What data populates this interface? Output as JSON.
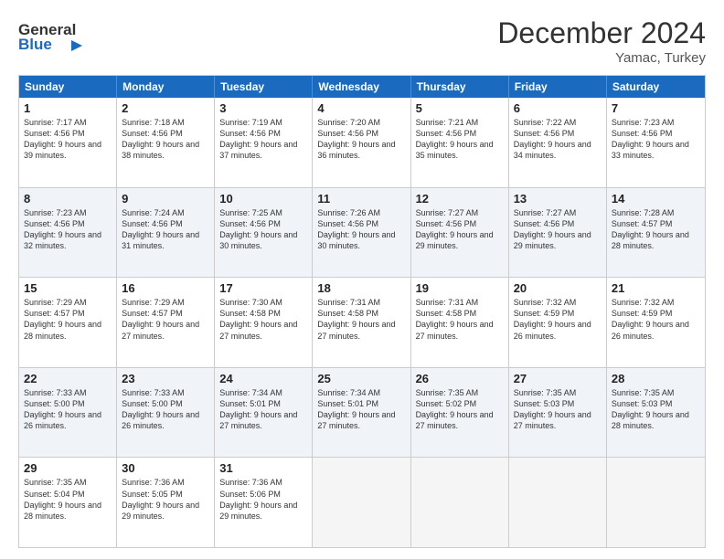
{
  "header": {
    "logo_general": "General",
    "logo_blue": "Blue",
    "month_title": "December 2024",
    "location": "Yamac, Turkey"
  },
  "calendar": {
    "days_of_week": [
      "Sunday",
      "Monday",
      "Tuesday",
      "Wednesday",
      "Thursday",
      "Friday",
      "Saturday"
    ],
    "weeks": [
      [
        {
          "day": "",
          "empty": true
        },
        {
          "day": "",
          "empty": true
        },
        {
          "day": "",
          "empty": true
        },
        {
          "day": "",
          "empty": true
        },
        {
          "day": "5",
          "sunrise": "7:21 AM",
          "sunset": "4:56 PM",
          "daylight": "9 hours and 35 minutes."
        },
        {
          "day": "6",
          "sunrise": "7:22 AM",
          "sunset": "4:56 PM",
          "daylight": "9 hours and 34 minutes."
        },
        {
          "day": "7",
          "sunrise": "7:23 AM",
          "sunset": "4:56 PM",
          "daylight": "9 hours and 33 minutes."
        }
      ],
      [
        {
          "day": "1",
          "sunrise": "7:17 AM",
          "sunset": "4:56 PM",
          "daylight": "9 hours and 39 minutes."
        },
        {
          "day": "2",
          "sunrise": "7:18 AM",
          "sunset": "4:56 PM",
          "daylight": "9 hours and 38 minutes."
        },
        {
          "day": "3",
          "sunrise": "7:19 AM",
          "sunset": "4:56 PM",
          "daylight": "9 hours and 37 minutes."
        },
        {
          "day": "4",
          "sunrise": "7:20 AM",
          "sunset": "4:56 PM",
          "daylight": "9 hours and 36 minutes."
        },
        {
          "day": "5",
          "sunrise": "7:21 AM",
          "sunset": "4:56 PM",
          "daylight": "9 hours and 35 minutes."
        },
        {
          "day": "6",
          "sunrise": "7:22 AM",
          "sunset": "4:56 PM",
          "daylight": "9 hours and 34 minutes."
        },
        {
          "day": "7",
          "sunrise": "7:23 AM",
          "sunset": "4:56 PM",
          "daylight": "9 hours and 33 minutes."
        }
      ],
      [
        {
          "day": "8",
          "sunrise": "7:23 AM",
          "sunset": "4:56 PM",
          "daylight": "9 hours and 32 minutes."
        },
        {
          "day": "9",
          "sunrise": "7:24 AM",
          "sunset": "4:56 PM",
          "daylight": "9 hours and 31 minutes."
        },
        {
          "day": "10",
          "sunrise": "7:25 AM",
          "sunset": "4:56 PM",
          "daylight": "9 hours and 30 minutes."
        },
        {
          "day": "11",
          "sunrise": "7:26 AM",
          "sunset": "4:56 PM",
          "daylight": "9 hours and 30 minutes."
        },
        {
          "day": "12",
          "sunrise": "7:27 AM",
          "sunset": "4:56 PM",
          "daylight": "9 hours and 29 minutes."
        },
        {
          "day": "13",
          "sunrise": "7:27 AM",
          "sunset": "4:56 PM",
          "daylight": "9 hours and 29 minutes."
        },
        {
          "day": "14",
          "sunrise": "7:28 AM",
          "sunset": "4:57 PM",
          "daylight": "9 hours and 28 minutes."
        }
      ],
      [
        {
          "day": "15",
          "sunrise": "7:29 AM",
          "sunset": "4:57 PM",
          "daylight": "9 hours and 28 minutes."
        },
        {
          "day": "16",
          "sunrise": "7:29 AM",
          "sunset": "4:57 PM",
          "daylight": "9 hours and 27 minutes."
        },
        {
          "day": "17",
          "sunrise": "7:30 AM",
          "sunset": "4:58 PM",
          "daylight": "9 hours and 27 minutes."
        },
        {
          "day": "18",
          "sunrise": "7:31 AM",
          "sunset": "4:58 PM",
          "daylight": "9 hours and 27 minutes."
        },
        {
          "day": "19",
          "sunrise": "7:31 AM",
          "sunset": "4:58 PM",
          "daylight": "9 hours and 27 minutes."
        },
        {
          "day": "20",
          "sunrise": "7:32 AM",
          "sunset": "4:59 PM",
          "daylight": "9 hours and 26 minutes."
        },
        {
          "day": "21",
          "sunrise": "7:32 AM",
          "sunset": "4:59 PM",
          "daylight": "9 hours and 26 minutes."
        }
      ],
      [
        {
          "day": "22",
          "sunrise": "7:33 AM",
          "sunset": "5:00 PM",
          "daylight": "9 hours and 26 minutes."
        },
        {
          "day": "23",
          "sunrise": "7:33 AM",
          "sunset": "5:00 PM",
          "daylight": "9 hours and 26 minutes."
        },
        {
          "day": "24",
          "sunrise": "7:34 AM",
          "sunset": "5:01 PM",
          "daylight": "9 hours and 27 minutes."
        },
        {
          "day": "25",
          "sunrise": "7:34 AM",
          "sunset": "5:01 PM",
          "daylight": "9 hours and 27 minutes."
        },
        {
          "day": "26",
          "sunrise": "7:35 AM",
          "sunset": "5:02 PM",
          "daylight": "9 hours and 27 minutes."
        },
        {
          "day": "27",
          "sunrise": "7:35 AM",
          "sunset": "5:03 PM",
          "daylight": "9 hours and 27 minutes."
        },
        {
          "day": "28",
          "sunrise": "7:35 AM",
          "sunset": "5:03 PM",
          "daylight": "9 hours and 28 minutes."
        }
      ],
      [
        {
          "day": "29",
          "sunrise": "7:35 AM",
          "sunset": "5:04 PM",
          "daylight": "9 hours and 28 minutes."
        },
        {
          "day": "30",
          "sunrise": "7:36 AM",
          "sunset": "5:05 PM",
          "daylight": "9 hours and 29 minutes."
        },
        {
          "day": "31",
          "sunrise": "7:36 AM",
          "sunset": "5:06 PM",
          "daylight": "9 hours and 29 minutes."
        },
        {
          "day": "",
          "empty": true
        },
        {
          "day": "",
          "empty": true
        },
        {
          "day": "",
          "empty": true
        },
        {
          "day": "",
          "empty": true
        }
      ]
    ],
    "week1": [
      {
        "day": "1",
        "sunrise": "7:17 AM",
        "sunset": "4:56 PM",
        "daylight": "9 hours and 39 minutes."
      },
      {
        "day": "2",
        "sunrise": "7:18 AM",
        "sunset": "4:56 PM",
        "daylight": "9 hours and 38 minutes."
      },
      {
        "day": "3",
        "sunrise": "7:19 AM",
        "sunset": "4:56 PM",
        "daylight": "9 hours and 37 minutes."
      },
      {
        "day": "4",
        "sunrise": "7:20 AM",
        "sunset": "4:56 PM",
        "daylight": "9 hours and 36 minutes."
      },
      {
        "day": "5",
        "sunrise": "7:21 AM",
        "sunset": "4:56 PM",
        "daylight": "9 hours and 35 minutes."
      },
      {
        "day": "6",
        "sunrise": "7:22 AM",
        "sunset": "4:56 PM",
        "daylight": "9 hours and 34 minutes."
      },
      {
        "day": "7",
        "sunrise": "7:23 AM",
        "sunset": "4:56 PM",
        "daylight": "9 hours and 33 minutes."
      }
    ]
  }
}
